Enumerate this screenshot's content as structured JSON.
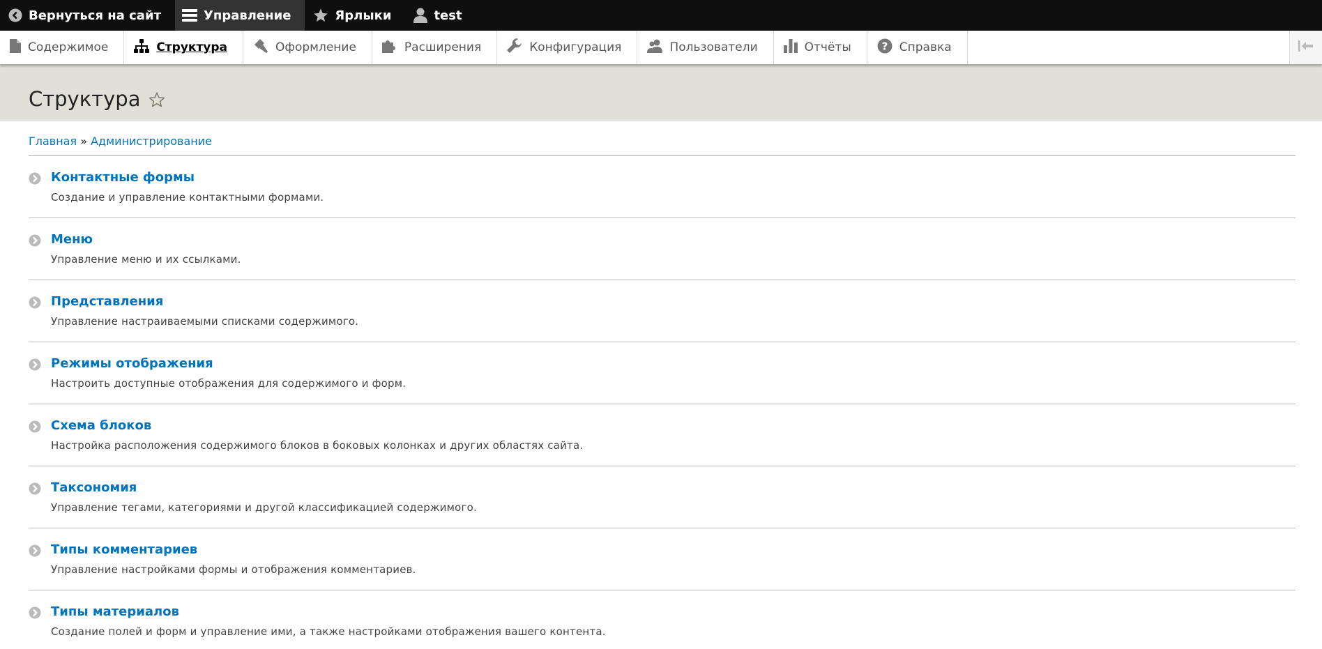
{
  "toolbar": {
    "back_label": "Вернуться на сайт",
    "manage_label": "Управление",
    "shortcuts_label": "Ярлыки",
    "user_label": "test"
  },
  "tray": {
    "items": [
      {
        "label": "Содержимое",
        "icon": "file-icon"
      },
      {
        "label": "Структура",
        "icon": "sitemap-icon"
      },
      {
        "label": "Оформление",
        "icon": "paintbrush-icon"
      },
      {
        "label": "Расширения",
        "icon": "puzzle-icon"
      },
      {
        "label": "Конфигурация",
        "icon": "wrench-icon"
      },
      {
        "label": "Пользователи",
        "icon": "people-icon"
      },
      {
        "label": "Отчёты",
        "icon": "bar-chart-icon"
      },
      {
        "label": "Справка",
        "icon": "help-icon"
      }
    ],
    "active_index": 1
  },
  "page": {
    "title": "Структура"
  },
  "breadcrumb": {
    "home": "Главная",
    "separator": "»",
    "admin": "Администрирование"
  },
  "admin_items": [
    {
      "title": "Контактные формы",
      "description": "Создание и управление контактными формами."
    },
    {
      "title": "Меню",
      "description": "Управление меню и их ссылками."
    },
    {
      "title": "Представления",
      "description": "Управление настраиваемыми списками содержимого."
    },
    {
      "title": "Режимы отображения",
      "description": "Настроить доступные отображения для содержимого и форм."
    },
    {
      "title": "Схема блоков",
      "description": "Настройка расположения содержимого блоков в боковых колонках и других областях сайта."
    },
    {
      "title": "Таксономия",
      "description": "Управление тегами, категориями и другой классификацией содержимого."
    },
    {
      "title": "Типы комментариев",
      "description": "Управление настройками формы и отображения комментариев."
    },
    {
      "title": "Типы материалов",
      "description": "Создание полей и форм и управление ими, а также настройками отображения вашего контента."
    }
  ],
  "colors": {
    "link": "#0074bd",
    "toolbar_bg": "#0f0f0f",
    "header_bg": "#e0e0d8"
  }
}
